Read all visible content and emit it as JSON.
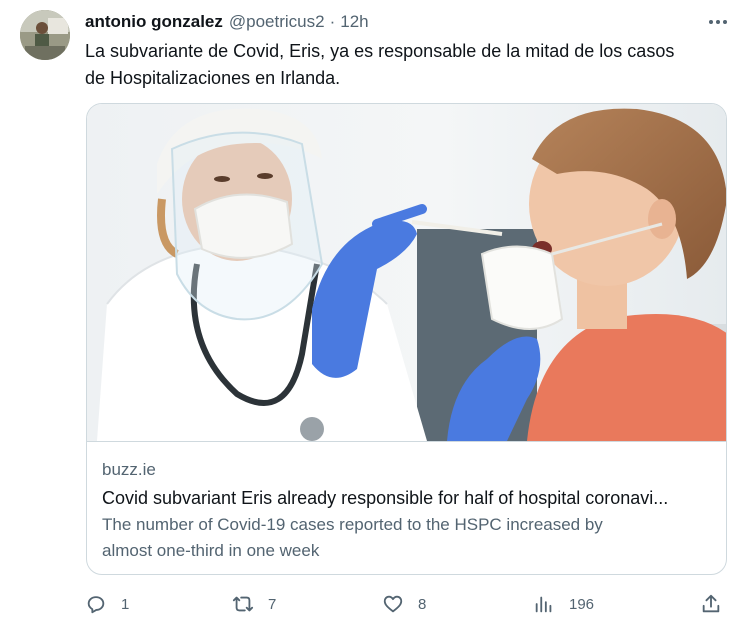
{
  "author": {
    "name": "antonio gonzalez",
    "handle": "@poetricus2",
    "separator": "·",
    "time": "12h"
  },
  "tweet": {
    "text_line1": "La subvariante de Covid, Eris, ya es responsable de la mitad de los casos",
    "text_line2": "de Hospitalizaciones en Irlanda."
  },
  "card": {
    "domain": "buzz.ie",
    "title": "Covid subvariant Eris already responsible for half of hospital coronavi...",
    "desc_line1": "The number of Covid-19 cases reported to the HSPC increased by",
    "desc_line2": "almost one-third in one week"
  },
  "actions": {
    "replies": "1",
    "retweets": "7",
    "likes": "8",
    "views": "196"
  },
  "icons": {
    "more": "more-dots-icon",
    "reply": "reply-icon",
    "retweet": "retweet-icon",
    "like": "heart-icon",
    "views": "views-chart-icon",
    "share": "share-icon"
  },
  "colors": {
    "text": "#0f1419",
    "secondary": "#536471",
    "border": "#cfd9de",
    "shirt": "#e9795c",
    "glove": "#4a7ae0"
  }
}
